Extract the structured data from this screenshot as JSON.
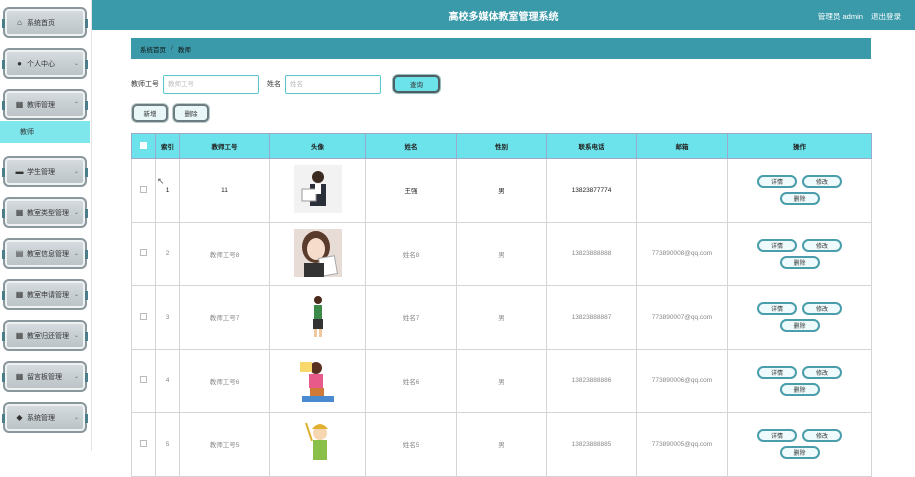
{
  "sidebar": {
    "items": [
      {
        "label": "系统首页",
        "icon": "home-icon"
      },
      {
        "label": "个人中心",
        "icon": "user-icon"
      },
      {
        "label": "教师管理",
        "icon": "grid-icon"
      },
      {
        "label": "学生管理",
        "icon": "briefcase-icon"
      },
      {
        "label": "教室类型管理",
        "icon": "grid-icon"
      },
      {
        "label": "教室信息管理",
        "icon": "clipboard-icon"
      },
      {
        "label": "教室申请管理",
        "icon": "grid-icon"
      },
      {
        "label": "教室归还管理",
        "icon": "grid-icon"
      },
      {
        "label": "留言板管理",
        "icon": "grid-icon"
      },
      {
        "label": "系统管理",
        "icon": "settings-icon"
      }
    ],
    "active_sub": "教师"
  },
  "header": {
    "title": "高校多媒体教室管理系统",
    "user": "管理员 admin",
    "logout": "退出登录"
  },
  "breadcrumb": {
    "home": "系统首页",
    "separator": "/",
    "current": "教师"
  },
  "search": {
    "id_label": "教师工号",
    "id_placeholder": "教师工号",
    "name_label": "姓名",
    "name_placeholder": "姓名",
    "query_label": "查询"
  },
  "toolbar": {
    "add_label": "新增",
    "delete_label": "删除"
  },
  "table": {
    "headers": [
      "",
      "索引",
      "教师工号",
      "头像",
      "姓名",
      "性别",
      "联系电话",
      "邮箱",
      "操作"
    ],
    "actions": {
      "detail": "详情",
      "edit": "修改",
      "delete": "删除"
    },
    "rows": [
      {
        "index": "1",
        "id": "11",
        "name": "王强",
        "gender": "男",
        "phone": "13823877774",
        "email": ""
      },
      {
        "index": "2",
        "id": "教师工号8",
        "name": "姓名8",
        "gender": "男",
        "phone": "13823888888",
        "email": "773890008@qq.com"
      },
      {
        "index": "3",
        "id": "教师工号7",
        "name": "姓名7",
        "gender": "男",
        "phone": "13823888887",
        "email": "773890007@qq.com"
      },
      {
        "index": "4",
        "id": "教师工号6",
        "name": "姓名6",
        "gender": "男",
        "phone": "13823888886",
        "email": "773890006@qq.com"
      },
      {
        "index": "5",
        "id": "教师工号5",
        "name": "姓名5",
        "gender": "男",
        "phone": "13823888885",
        "email": "773890005@qq.com"
      }
    ]
  },
  "colors": {
    "accent": "#3a9aaa",
    "header_cell": "#6ce3ea"
  }
}
